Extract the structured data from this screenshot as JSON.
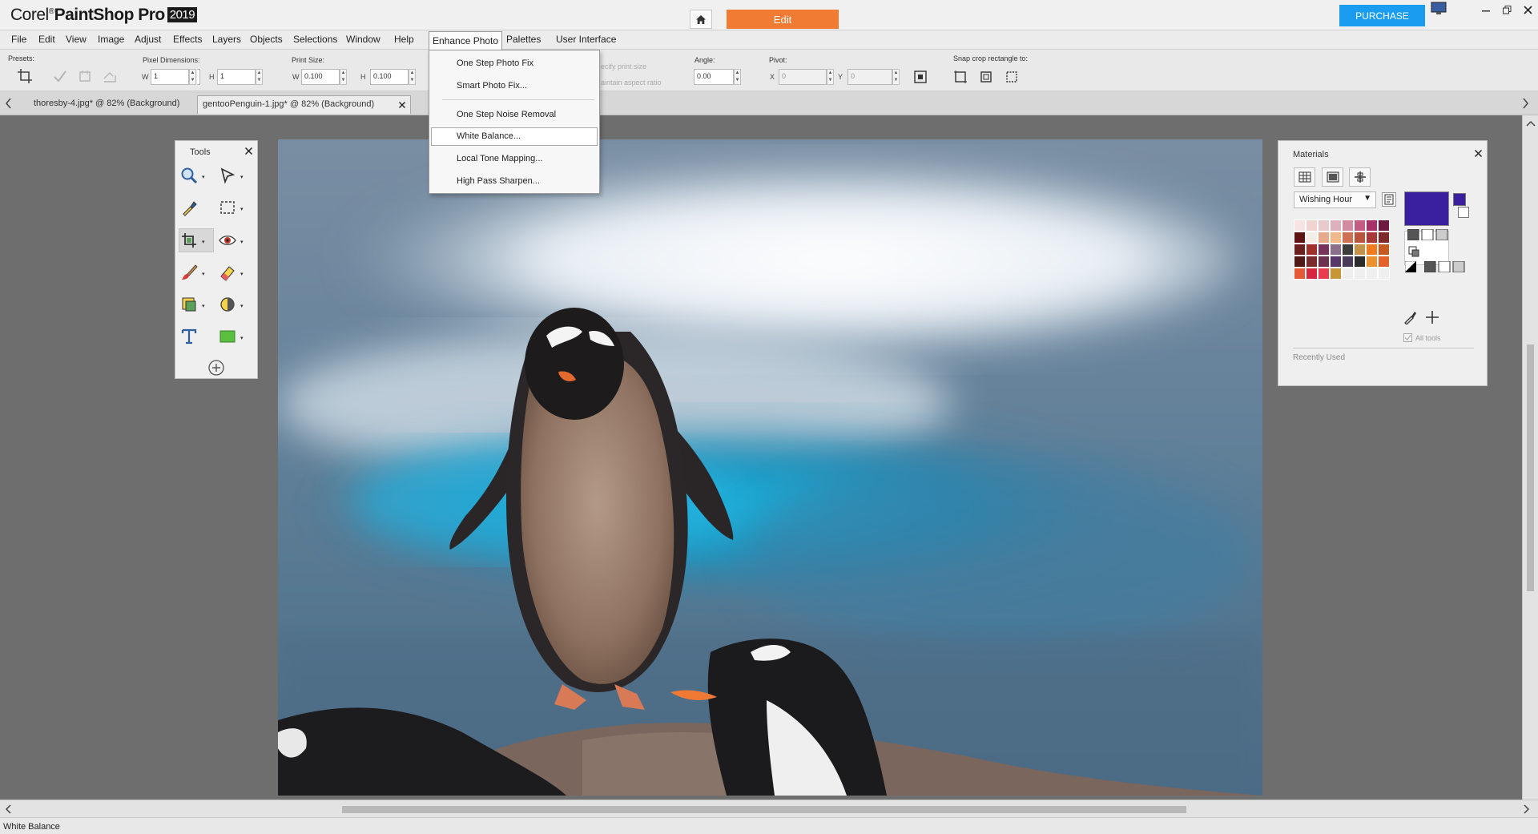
{
  "app": {
    "brand": "Corel",
    "name": "PaintShop Pro",
    "year": "2019",
    "home_icon": "home-icon",
    "workspace_tab": "Edit",
    "purchase_label": "PURCHASE",
    "accent_color": "#f27b33",
    "purchase_color": "#1a9df0"
  },
  "menubar": {
    "items": [
      "File",
      "Edit",
      "View",
      "Image",
      "Adjust",
      "Effects",
      "Layers",
      "Objects",
      "Selections",
      "Window",
      "Help",
      "Enhance Photo",
      "Palettes",
      "User Interface"
    ],
    "active": "Enhance Photo"
  },
  "enhance_menu": {
    "items": [
      "One Step Photo Fix",
      "Smart Photo Fix...",
      "One Step Noise Removal",
      "White Balance...",
      "Local Tone Mapping...",
      "High Pass Sharpen..."
    ],
    "highlighted": "White Balance..."
  },
  "toolbar": {
    "presets_label": "Presets:",
    "pixel_dimensions_label": "Pixel Dimensions:",
    "w_label": "W",
    "h_label": "H",
    "pixel_w": "1",
    "pixel_h": "1",
    "print_size_label": "Print Size:",
    "print_w": "0.100",
    "print_h": "0.100",
    "specify_print_size": "ecify print size",
    "maintain_aspect": "aintain aspect ratio",
    "angle_label": "Angle:",
    "angle_value": "0.00",
    "pivot_label": "Pivot:",
    "x_label": "X",
    "y_label": "Y",
    "pivot_x": "0",
    "pivot_y": "0",
    "snap_crop_label": "Snap crop rectangle to:"
  },
  "documents": {
    "tabs": [
      {
        "label": "thoresby-4.jpg* @  82% (Background)"
      },
      {
        "label": "gentooPenguin-1.jpg* @  82% (Background)"
      }
    ],
    "close_icon": "close-icon"
  },
  "tools_palette": {
    "title": "Tools",
    "tools": [
      "zoom-tool",
      "pick-tool",
      "dropper-tool",
      "selection-tool",
      "crop-tool",
      "red-eye-tool",
      "paint-brush-tool",
      "eraser-tool",
      "clone-tool",
      "dodge-tool",
      "text-tool",
      "rectangle-tool",
      "add-tool"
    ]
  },
  "materials_palette": {
    "title": "Materials",
    "swatch_set": "Wishing Hour",
    "foreground_color": "#3a1f9e",
    "background_color": "#ffffff",
    "all_tools_label": "All tools",
    "recently_used_label": "Recently Used",
    "swatches": [
      "#f7e3e1",
      "#f3d3d0",
      "#e8c9cc",
      "#dcb1bb",
      "#d38ba0",
      "#c25c81",
      "#a63067",
      "#6e1a3e",
      "#5e1212",
      "#f4ece6",
      "#e6a98a",
      "#f1b98b",
      "#cf7153",
      "#b8553c",
      "#a73a38",
      "#7f2a2a",
      "#6b1f1f",
      "#a0302b",
      "#77325d",
      "#8c6f8a",
      "#3d3d3d",
      "#c49148",
      "#f07c1e",
      "#c45a22",
      "#4f1a14",
      "#7a2b2b",
      "#6e3050",
      "#58386a",
      "#4a3c58",
      "#2c2c2c",
      "#ea9130",
      "#e2622a",
      "#e55a34",
      "#d7263f",
      "#e93d4f",
      "#c79736",
      "#efefef",
      "#efefef",
      "#efefef",
      "#efefef"
    ]
  },
  "status": {
    "text": "White Balance"
  }
}
